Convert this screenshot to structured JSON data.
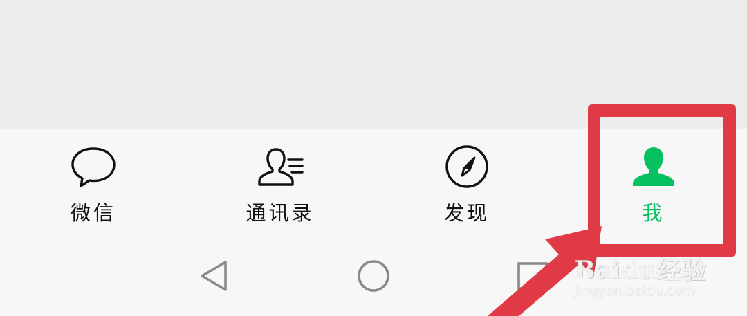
{
  "tabbar": {
    "tabs": [
      {
        "label": "微信",
        "icon": "chat-bubble-icon",
        "active": false
      },
      {
        "label": "通讯录",
        "icon": "contacts-icon",
        "active": false
      },
      {
        "label": "发现",
        "icon": "compass-icon",
        "active": false
      },
      {
        "label": "我",
        "icon": "person-icon",
        "active": true
      }
    ]
  },
  "navbar": {
    "buttons": [
      "back-icon",
      "home-icon",
      "recents-icon"
    ]
  },
  "annotation": {
    "highlight_color": "#e13a47"
  },
  "watermark": {
    "brand": "Baidu经验",
    "url": "jingyan.baidu.com"
  },
  "colors": {
    "active_tab": "#07c160",
    "inactive_tab": "#111111",
    "tabbar_bg": "#f7f7f7",
    "page_bg": "#ededed"
  }
}
